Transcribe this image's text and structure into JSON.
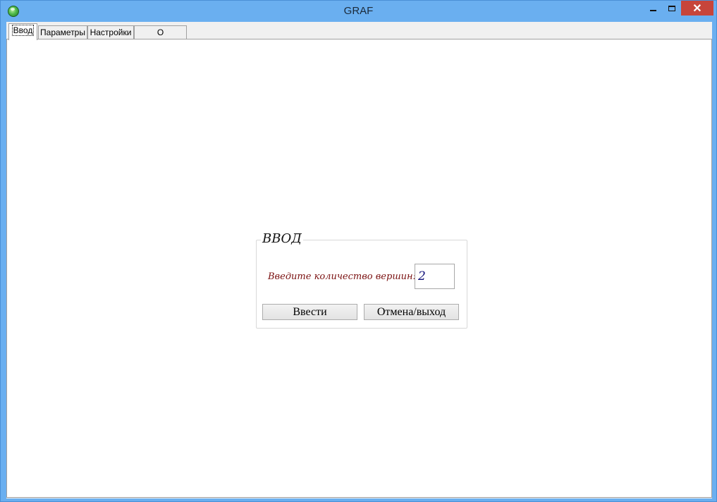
{
  "window": {
    "title": "GRAF",
    "close_glyph": "✕",
    "icon": "app-globe-icon"
  },
  "tabs": [
    {
      "label": "Ввод",
      "active": true
    },
    {
      "label": "Параметры",
      "active": false
    },
    {
      "label": "Настройки",
      "active": false
    },
    {
      "label": "О программе",
      "active": false
    }
  ],
  "input_group": {
    "title": "ВВОД",
    "prompt": "Введите количество вершин:",
    "vertex_count": "2",
    "enter_button": "Ввести",
    "cancel_button": "Отмена/выход"
  },
  "colors": {
    "title_bar": "#6aaff0",
    "close_button": "#c7453a",
    "prompt_text": "#7a1010",
    "input_text": "#12127a"
  }
}
